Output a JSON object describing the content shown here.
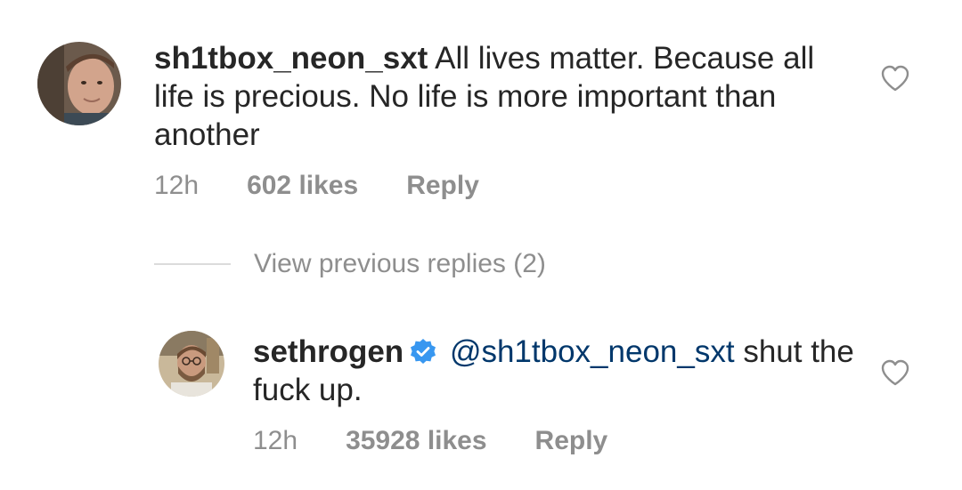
{
  "comment": {
    "username": "sh1tbox_neon_sxt",
    "text": "All lives matter.  Because all life is precious. No life is more important than another",
    "time": "12h",
    "likes": "602 likes",
    "reply_label": "Reply"
  },
  "view_previous_replies": "View previous replies (2)",
  "reply": {
    "username": "sethrogen",
    "verified": true,
    "mention": "@sh1tbox_neon_sxt",
    "text": "shut the fuck up.",
    "time": "12h",
    "likes": "35928 likes",
    "reply_label": "Reply"
  },
  "colors": {
    "text": "#262626",
    "meta": "#8e8e8e",
    "mention": "#00376b",
    "verified": "#3897f0",
    "divider": "#dbdbdb"
  },
  "icons": {
    "like": "heart-outline-icon",
    "verified": "verified-badge-icon"
  }
}
